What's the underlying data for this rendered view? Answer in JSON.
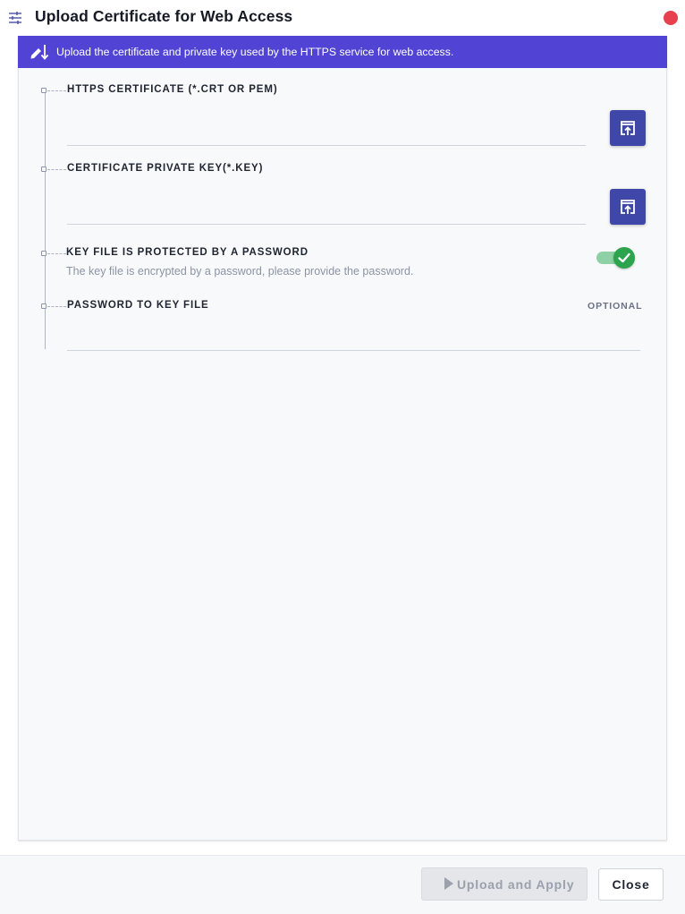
{
  "window": {
    "title": "Upload Certificate for Web Access",
    "title_icon": "sliders-icon",
    "close_icon": "close-dot-icon"
  },
  "banner": {
    "icon": "write-down-icon",
    "text": "Upload the certificate and private key used by the HTTPS service for web access."
  },
  "form": {
    "https_certificate": {
      "label": "HTTPS CERTIFICATE (*.CRT OR PEM)",
      "value": "",
      "button_icon": "upload-file-icon"
    },
    "private_key": {
      "label": "CERTIFICATE PRIVATE KEY(*.KEY)",
      "value": "",
      "button_icon": "upload-file-icon"
    },
    "password_protected": {
      "label": "KEY FILE IS PROTECTED BY A PASSWORD",
      "help": "The key file is encrypted by a password, please provide the password.",
      "checked": true
    },
    "key_password": {
      "label": "PASSWORD TO KEY FILE",
      "tag": "OPTIONAL",
      "value": ""
    }
  },
  "footer": {
    "upload_label": "Upload and Apply",
    "upload_enabled": false,
    "close_label": "Close"
  },
  "colors": {
    "accent": "#5143d3",
    "button": "#3f48a8",
    "toggle_on": "#2ba44d",
    "close_dot": "#e5414f"
  }
}
